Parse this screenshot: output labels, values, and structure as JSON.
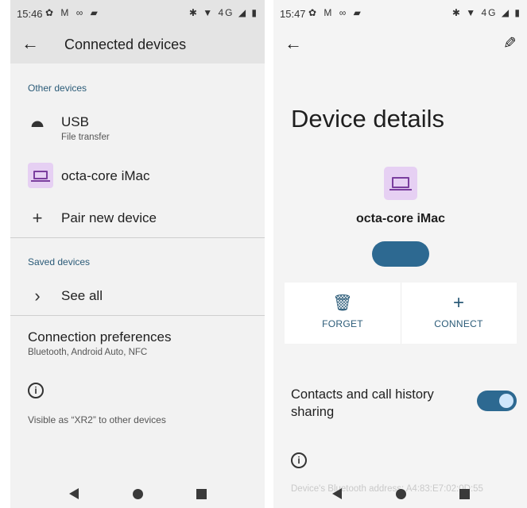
{
  "left": {
    "status": {
      "time": "15:46",
      "left_icons": "✿ M ∞ ▰",
      "right_icons": "✱ ▼ 4G ◢ ▮"
    },
    "toolbar": {
      "title": "Connected devices"
    },
    "other_devices": {
      "header": "Other devices",
      "usb": {
        "title": "USB",
        "subtitle": "File transfer"
      },
      "device": {
        "title": "octa-core iMac"
      },
      "pair": {
        "title": "Pair new device",
        "icon": "+"
      }
    },
    "saved_devices": {
      "header": "Saved devices",
      "see_all": "See all",
      "icon": "›"
    },
    "preferences": {
      "title": "Connection preferences",
      "subtitle": "Bluetooth, Android Auto, NFC"
    },
    "info_icon": "i",
    "visible_as": "Visible as “XR2” to other devices"
  },
  "right": {
    "status": {
      "time": "15:47",
      "left_icons": "✿ M ∞ ▰",
      "right_icons": "✱ ▼ 4G ◢ ▮"
    },
    "title": "Device details",
    "device_name": "octa-core iMac",
    "actions": {
      "forget": {
        "label": "FORGET",
        "icon": "🗑"
      },
      "connect": {
        "label": "CONNECT",
        "icon": "+"
      }
    },
    "contacts_toggle": {
      "label": "Contacts and call history sharing",
      "on": true
    },
    "info_icon": "i",
    "bt_address": "Device's Bluetooth address: A4:83:E7:02:0D:55"
  },
  "colors": {
    "accent": "#2d6991",
    "section_text": "#2b5b78",
    "chip_bg": "#e6d0f3",
    "chip_fg": "#7a3e9e"
  },
  "icons": [
    "back-arrow-icon",
    "usb-icon",
    "laptop-icon",
    "plus-icon",
    "chevron-right-icon",
    "info-icon",
    "edit-pencil-icon",
    "trash-icon",
    "nav-back-icon",
    "nav-home-icon",
    "nav-recents-icon"
  ]
}
